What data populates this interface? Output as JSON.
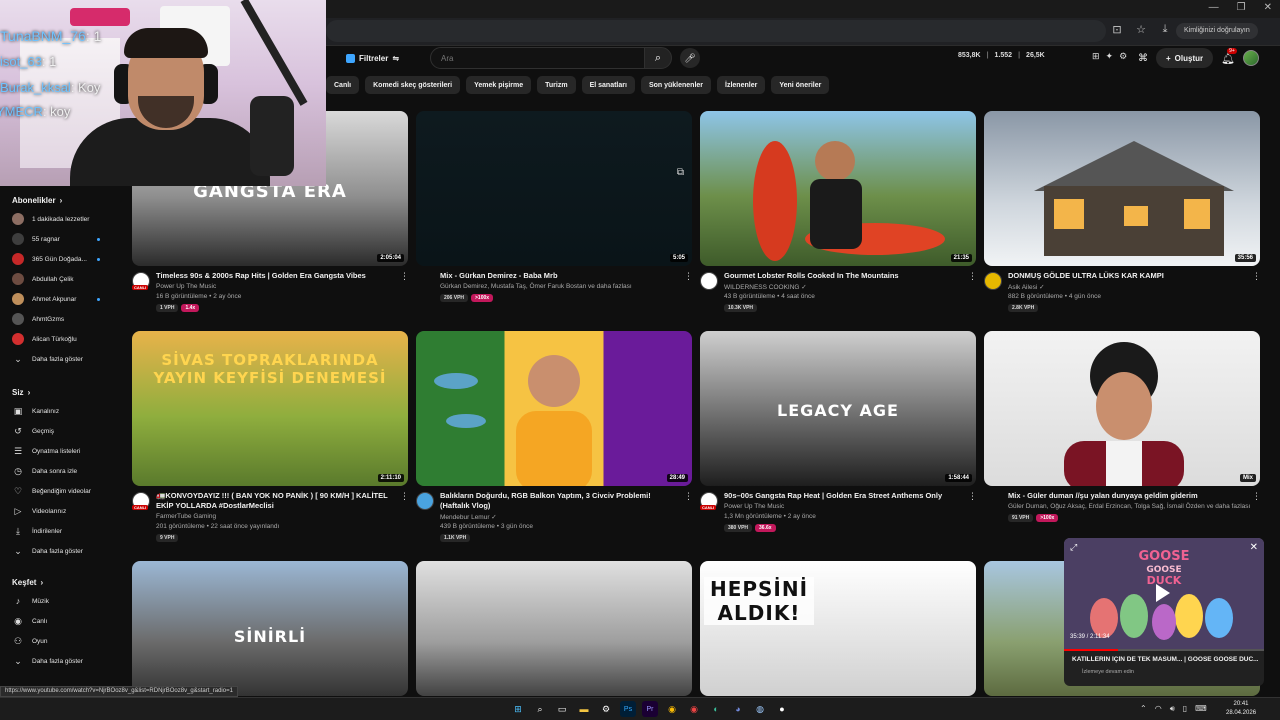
{
  "browser": {
    "profile_chip": "Kimliğinizi doğrulayın",
    "window_controls": [
      "—",
      "❐",
      "✕"
    ]
  },
  "header": {
    "filters_label": "Filtreler",
    "search_placeholder": "Ara",
    "stats": [
      "853,8K",
      "1.552",
      "26,5K"
    ],
    "create_label": "Oluştur",
    "notification_count": "9+"
  },
  "chips": [
    "Canlı",
    "Komedi skeç gösterileri",
    "Yemek pişirme",
    "Turizm",
    "El sanatları",
    "Son yüklenenler",
    "İzlenenler",
    "Yeni öneriler"
  ],
  "sidebar": {
    "subscriptions_title": "Abonelikler",
    "subscriptions": [
      {
        "label": "1 dakikada lezzetler",
        "color": "#8d6e63",
        "dot": false
      },
      {
        "label": "55 ragnar",
        "color": "#3e3e3e",
        "dot": true
      },
      {
        "label": "365 Gün Doğada...",
        "color": "#c62828",
        "dot": true
      },
      {
        "label": "Abdullah Çelik",
        "color": "#6d4c41",
        "dot": false
      },
      {
        "label": "Ahmet Akpunar",
        "color": "#bf8f5b",
        "dot": true
      },
      {
        "label": "AhmtGzms",
        "color": "#555555",
        "dot": false
      },
      {
        "label": "Alican Türkoğlu",
        "color": "#d32f2f",
        "dot": false
      }
    ],
    "subs_more": "Daha fazla göster",
    "you_title": "Siz",
    "you_items": [
      {
        "label": "Kanalınız",
        "icon": "▣"
      },
      {
        "label": "Geçmiş",
        "icon": "↺"
      },
      {
        "label": "Oynatma listeleri",
        "icon": "☰"
      },
      {
        "label": "Daha sonra izle",
        "icon": "◷"
      },
      {
        "label": "Beğendiğim videolar",
        "icon": "♡"
      },
      {
        "label": "Videolarınız",
        "icon": "▷"
      },
      {
        "label": "İndirilenler",
        "icon": "⤓"
      }
    ],
    "you_more": "Daha fazla göster",
    "explore_title": "Keşfet",
    "explore_items": [
      {
        "label": "Müzik",
        "icon": "♪"
      },
      {
        "label": "Canlı",
        "icon": "◉"
      },
      {
        "label": "Oyun",
        "icon": "⚇"
      },
      {
        "label": "Daha fazla göster",
        "icon": "⌄"
      }
    ]
  },
  "videos": [
    {
      "title": "Timeless 90s & 2000s Rap Hits | Golden Era Gangsta Vibes",
      "channel": "Power Up The Music",
      "views": "16 B görüntüleme • 2 ay önce",
      "duration": "2:05:04",
      "badges": [
        "1 VPH",
        "1.4x"
      ],
      "thumb_text": "GANGSTA ERA",
      "avatar": "#ffffff",
      "live": true
    },
    {
      "title": "Mix - Gürkan Demirez - Baba Mrb",
      "channel": "Gürkan Demirez, Mustafa Taş, Ömer Faruk Bostan ve daha fazlası",
      "views": "",
      "duration": "5:05",
      "badges": [
        "206 VPH",
        ">100x"
      ],
      "thumb_text": "",
      "avatar": "",
      "live": false
    },
    {
      "title": "Gourmet Lobster Rolls Cooked In The Mountains",
      "channel": "WILDERNESS COOKING ✓",
      "views": "43 B görüntüleme • 4 saat önce",
      "duration": "21:35",
      "badges": [
        "10.3K VPH"
      ],
      "thumb_text": "",
      "avatar": "#ffffff",
      "live": false
    },
    {
      "title": "DONMUŞ GÖLDE ULTRA LÜKS KAR KAMPI",
      "channel": "Asik Ailesi ✓",
      "views": "882 B görüntüleme • 4 gün önce",
      "duration": "35:56",
      "badges": [
        "2.8K VPH"
      ],
      "thumb_text": "",
      "avatar": "#e6b800",
      "live": false
    },
    {
      "title": "🚛KONVOYDAYIZ !!! ( BAN YOK NO PANİK ) [ 90 KM/H ] KALİTEL EKİP YOLLARDA #DostlarMeclisi",
      "channel": "FarmerTube Gaming",
      "views": "201 görüntüleme • 22 saat önce yayınlandı",
      "duration": "2:11:10",
      "badges": [
        "9 VPH"
      ],
      "thumb_text": "SİVAS TOPRAKLARINDA YAYIN KEYFİSİ DENEMESİ",
      "avatar": "#ffffff",
      "live": true
    },
    {
      "title": "Balıkların Doğurdu, RGB Balkon Yaptım, 3 Civciv Problemi! (Haftalık Vlog)",
      "channel": "Mendebur Lemur ✓",
      "views": "439 B görüntüleme • 3 gün önce",
      "duration": "28:49",
      "badges": [
        "1.1K VPH"
      ],
      "thumb_text": "",
      "avatar": "#4aa3df",
      "live": false
    },
    {
      "title": "90s–00s Gangsta Rap Heat | Golden Era Street Anthems Only",
      "channel": "Power Up The Music",
      "views": "1,3 Mn görüntüleme • 2 ay önce",
      "duration": "1:58:44",
      "badges": [
        "380 VPH",
        "36.6x"
      ],
      "thumb_text": "LEGACY AGE",
      "avatar": "#ffffff",
      "live": true
    },
    {
      "title": "Mix - Güler duman //şu yalan dunyaya geldim giderim",
      "channel": "Güler Duman, Oğuz Aksaç, Erdal Erzincan, Tolga Sağ, İsmail Özden ve daha fazlası",
      "views": "",
      "duration": "Mix",
      "badges": [
        "91 VPH",
        ">100x"
      ],
      "thumb_text": "",
      "avatar": "",
      "live": false
    },
    {
      "title": "",
      "channel": "",
      "views": "",
      "duration": "",
      "badges": [],
      "thumb_text": "SİNİRLİ",
      "avatar": "",
      "live": false
    },
    {
      "title": "",
      "channel": "",
      "views": "",
      "duration": "",
      "badges": [],
      "thumb_text": "",
      "avatar": "",
      "live": false
    },
    {
      "title": "",
      "channel": "",
      "views": "",
      "duration": "",
      "badges": [],
      "thumb_text": "HEPSİNİ ALDIK!",
      "avatar": "",
      "live": false
    },
    {
      "title": "",
      "channel": "",
      "views": "",
      "duration": "",
      "badges": [],
      "thumb_text": "",
      "avatar": "",
      "live": false
    }
  ],
  "miniplayer": {
    "title": "KATİLLERİN İÇİN DE TEK MASUM... | GOOSE GOOSE DUC...",
    "subtitle": "İzlemeye devam edin",
    "time": "35:39 / 2:11:34",
    "progress": 0.27
  },
  "chat": [
    {
      "user": "TunaBNM_76",
      "text": ": 1"
    },
    {
      "user": "isot_63",
      "text": ": 1"
    },
    {
      "user": "Burak_kksal",
      "text": ": Koy"
    },
    {
      "user": "YMECR",
      "text": ": koy"
    }
  ],
  "statusbar": "https://www.youtube.com/watch?v=NjrBOoz8v_g&list=RDNjrBOoz8v_g&start_radio=1",
  "clock": {
    "time": "20:41",
    "date": "28.04.2026"
  }
}
